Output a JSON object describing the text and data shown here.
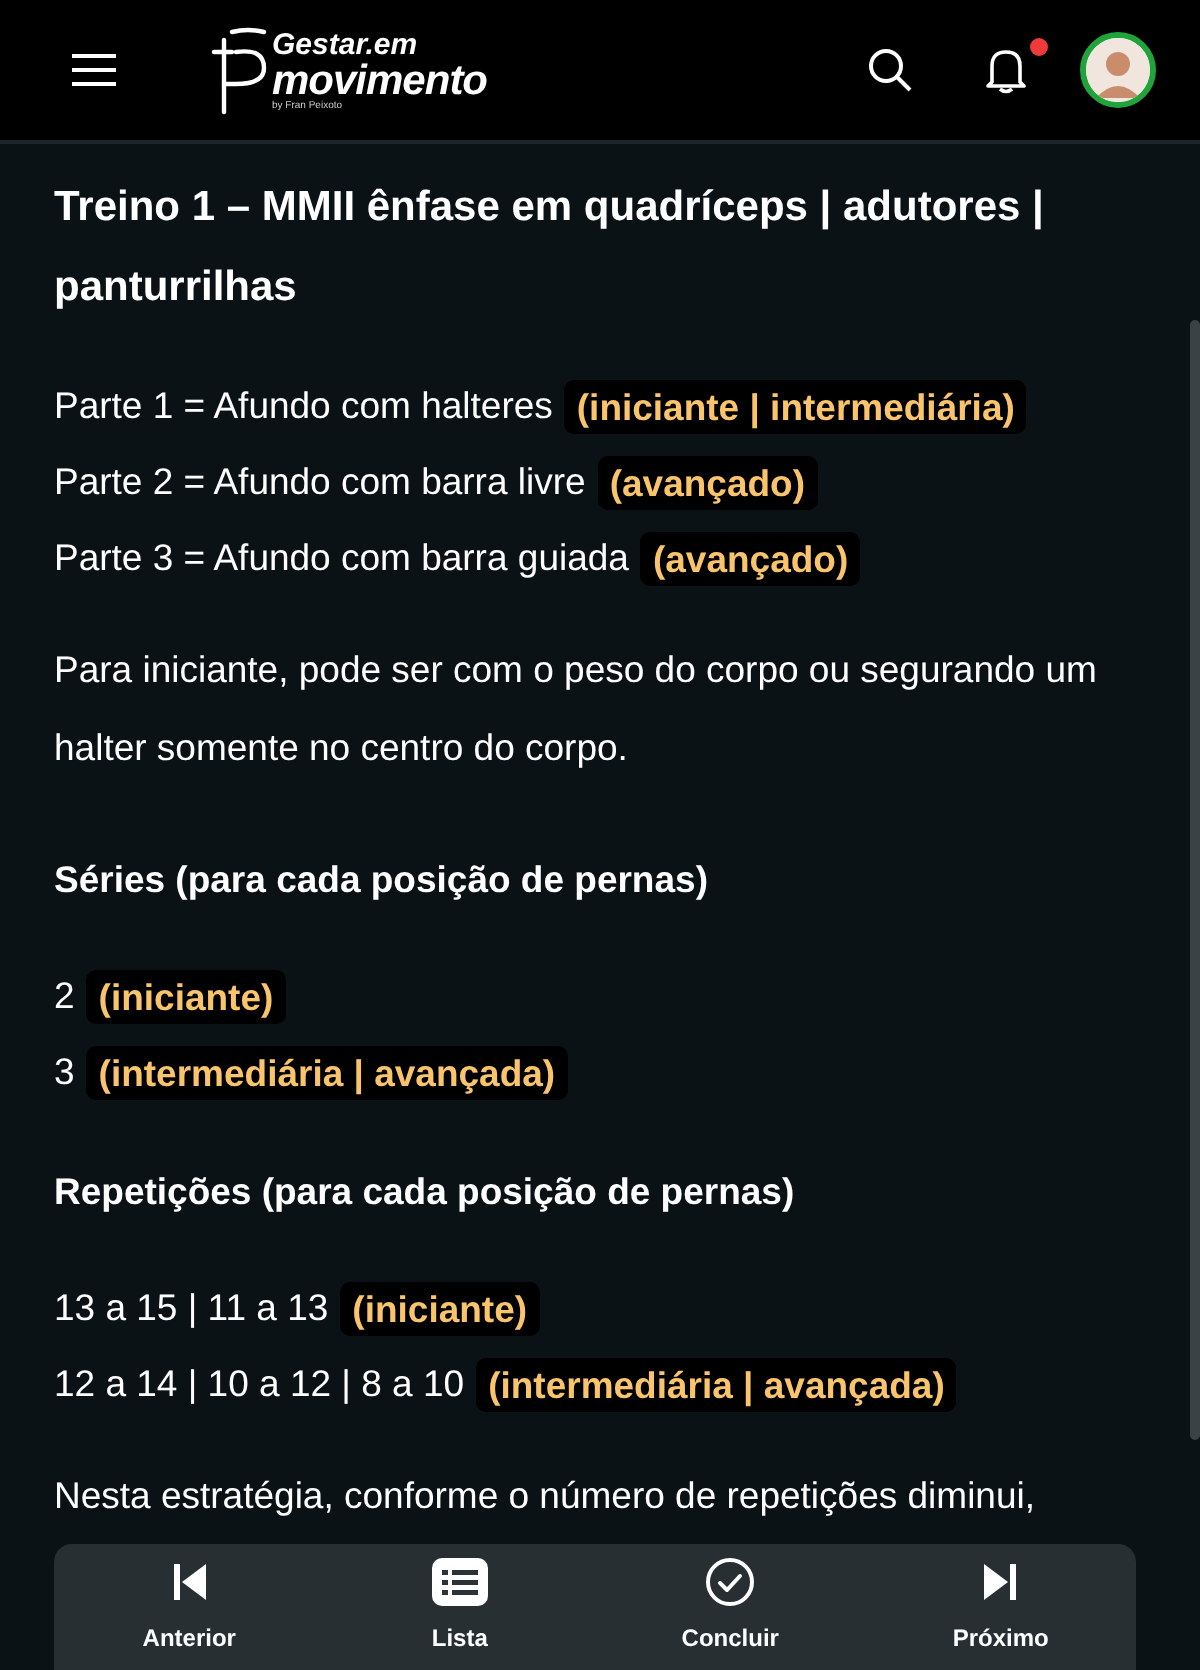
{
  "header": {
    "logo": {
      "top": "Gestar.em",
      "main": "movimento",
      "byline": "by Fran Peixoto"
    },
    "notification_dot": true
  },
  "article": [
    {
      "kind": "title",
      "parts": [
        {
          "text": "Treino 1 – MMII ênfase em quadríceps | adutores | panturrilhas",
          "kind": "plain"
        }
      ]
    },
    {
      "kind": "line",
      "parts": [
        {
          "text": "Parte 1 = Afundo com halteres",
          "kind": "plain"
        },
        {
          "text": "(iniciante | intermediária)",
          "kind": "tag"
        }
      ]
    },
    {
      "kind": "line",
      "parts": [
        {
          "text": "Parte 2 = Afundo com barra livre",
          "kind": "plain"
        },
        {
          "text": "(avançado)",
          "kind": "tag"
        }
      ]
    },
    {
      "kind": "line",
      "parts": [
        {
          "text": "Parte 3 =  Afundo com barra guiada",
          "kind": "plain"
        },
        {
          "text": "(avançado)",
          "kind": "tag"
        }
      ]
    },
    {
      "kind": "paragraph",
      "parts": [
        {
          "text": "Para iniciante, pode ser com o peso do corpo ou segurando um halter somente no centro do corpo.",
          "kind": "plain"
        }
      ]
    },
    {
      "kind": "heading",
      "parts": [
        {
          "text": "Séries (para cada posição de pernas)",
          "kind": "plain"
        }
      ]
    },
    {
      "kind": "line",
      "parts": [
        {
          "text": "2",
          "kind": "plain"
        },
        {
          "text": "(iniciante)",
          "kind": "tag"
        }
      ]
    },
    {
      "kind": "line",
      "parts": [
        {
          "text": "3",
          "kind": "plain"
        },
        {
          "text": "(intermediária | avançada)",
          "kind": "tag"
        }
      ]
    },
    {
      "kind": "heading",
      "parts": [
        {
          "text": "Repetições (para cada posição de pernas)",
          "kind": "plain"
        }
      ]
    },
    {
      "kind": "line",
      "parts": [
        {
          "text": "13 a 15 | 11 a 13",
          "kind": "plain"
        },
        {
          "text": "(iniciante)",
          "kind": "tag"
        }
      ]
    },
    {
      "kind": "line",
      "parts": [
        {
          "text": "12 a 14 | 10 a 12 | 8 a 10",
          "kind": "plain"
        },
        {
          "text": "(intermediária | avançada)",
          "kind": "tag"
        }
      ]
    },
    {
      "kind": "paragraph",
      "parts": [
        {
          "text": "Nesta estratégia, conforme o número de repetições diminui,",
          "kind": "plain"
        }
      ]
    }
  ],
  "bottom_nav": [
    {
      "kind": "previous",
      "label": "Anterior"
    },
    {
      "kind": "list",
      "label": "Lista"
    },
    {
      "kind": "complete",
      "label": "Concluir"
    },
    {
      "kind": "next",
      "label": "Próximo"
    }
  ]
}
